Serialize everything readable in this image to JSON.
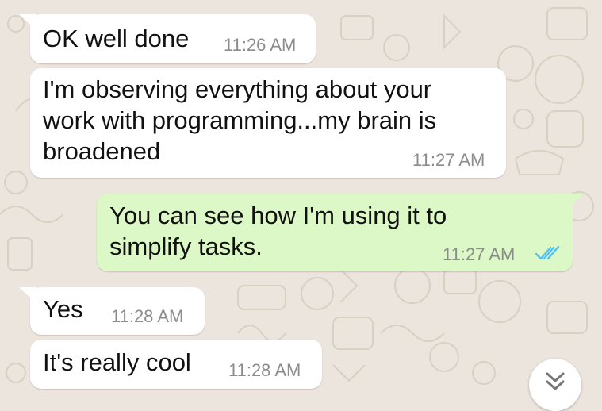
{
  "messages": [
    {
      "direction": "incoming",
      "text": "OK well done",
      "time": "11:26 AM"
    },
    {
      "direction": "incoming",
      "lines": [
        "I'm observing everything about your",
        "work with programming...my brain is",
        "broadened"
      ],
      "time": "11:27 AM"
    },
    {
      "direction": "outgoing",
      "lines": [
        "You can see how I'm using it to",
        "simplify tasks."
      ],
      "time": "11:27 AM",
      "status": "read"
    },
    {
      "direction": "incoming",
      "text": "Yes",
      "time": "11:28 AM"
    },
    {
      "direction": "incoming",
      "text": "It's really cool",
      "time": "11:28 AM"
    }
  ],
  "scroll_button": {
    "icon": "double-chevron-down-icon"
  },
  "colors": {
    "wallpaper": "#ece5dd",
    "incoming_bubble": "#ffffff",
    "outgoing_bubble": "#dcf8c6",
    "read_ticks": "#4fc3f7",
    "timestamp": "#8c8c8c"
  }
}
